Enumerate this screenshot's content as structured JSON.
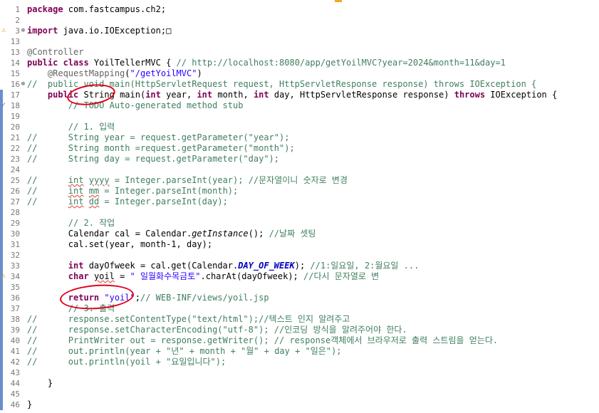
{
  "editor": {
    "lines": [
      {
        "n": "1",
        "html": "<span class='kw'>package</span> com.fastcampus.ch2;"
      },
      {
        "n": "2",
        "html": ""
      },
      {
        "n": "3",
        "html": "<span class='kw'>import</span> java.io.IOException;□"
      },
      {
        "n": "13",
        "html": ""
      },
      {
        "n": "13",
        "html": "<span class='ann'>@Controller</span>"
      },
      {
        "n": "14",
        "html": "<span class='kw'>public class</span> YoilTellerMVC { <span class='cm'>// http://localhost:8080/app/getYoilMVC?year=2024&month=11&day=1</span>"
      },
      {
        "n": "15",
        "html": "    <span class='ann'>@RequestMapping</span>(<span class='str'>\"/getYoilMVC\"</span>)"
      },
      {
        "n": "16",
        "html": "<span class='cm'>//  public void main(HttpServletRequest request, HttpServletResponse response) throws IOException {</span>"
      },
      {
        "n": "17",
        "html": "    <span class='kw'>public</span> String main(<span class='kw'>int</span> year, <span class='kw'>int</span> month, <span class='kw'>int</span> day, HttpServletResponse response) <span class='kw'>throws</span> IOException {"
      },
      {
        "n": "18",
        "html": "        <span class='cm'>// TODO Auto-generated method stub</span>"
      },
      {
        "n": "19",
        "html": ""
      },
      {
        "n": "20",
        "html": "        <span class='cm'>// 1. 입력</span>"
      },
      {
        "n": "21",
        "html": "<span class='cm'>//      String year = request.getParameter(\"year\");</span>"
      },
      {
        "n": "22",
        "html": "<span class='cm'>//      String month =request.getParameter(\"month\");</span>"
      },
      {
        "n": "23",
        "html": "<span class='cm'>//      String day = request.getParameter(\"day\");</span>"
      },
      {
        "n": "24",
        "html": ""
      },
      {
        "n": "25",
        "html": "<span class='cm'>//      <span class='sq'>int</span> <span class='sq'>yyyy</span> = Integer.parseInt(year); //문자열이니 숫자로 변경</span>"
      },
      {
        "n": "26",
        "html": "<span class='cm'>//      <span class='sq'>int</span> <span class='sq'>mm</span> = Integer.parseInt(month);</span>"
      },
      {
        "n": "27",
        "html": "<span class='cm'>//      <span class='sq'>int</span> <span class='sq'>dd</span> = Integer.parseInt(day);</span>"
      },
      {
        "n": "28",
        "html": ""
      },
      {
        "n": "29",
        "html": "        <span class='cm'>// 2. 작업</span>"
      },
      {
        "n": "30",
        "html": "        Calendar cal = Calendar.<span class='st'>getInstance</span>(); <span class='cm'>//날짜 셋팅</span>"
      },
      {
        "n": "31",
        "html": "        cal.set(year, month-1, day);"
      },
      {
        "n": "32",
        "html": ""
      },
      {
        "n": "33",
        "html": "        <span class='kw'>int</span> dayOfweek = cal.get(Calendar.<span class='fld'>DAY_OF_WEEK</span>); <span class='cm'>//1:일요일, 2:월요일 ...</span>"
      },
      {
        "n": "34",
        "html": "        <span class='kw'>char</span> <span class='sq'>yoil</span> = <span class='str'>\" 일월화수목금토\"</span>.charAt(dayOfweek); <span class='cm'>//다시 문자열로 변</span>"
      },
      {
        "n": "35",
        "html": ""
      },
      {
        "n": "36",
        "html": "        <span class='kw'>return</span> <span class='str'>\"yoil\"</span>;<span class='cm'>// WEB-INF/views/yoil.jsp</span>"
      },
      {
        "n": "37",
        "html": "        <span class='cm'>// 3. 출력</span>"
      },
      {
        "n": "38",
        "html": "<span class='cm'>//      response.setContentType(\"text/html\");//텍스트 인지 알려주고</span>"
      },
      {
        "n": "39",
        "html": "<span class='cm'>//      response.setCharacterEncoding(\"utf-8\"); //인코딩 방식을 알려주어야 한다.</span>"
      },
      {
        "n": "40",
        "html": "<span class='cm'>//      PrintWriter out = response.getWriter(); // response객체에서 브라우저로 출력 스트림을 얻는다.</span>"
      },
      {
        "n": "41",
        "html": "<span class='cm'>//      out.println(year + \"년\" + month + \"월\" + day + \"일은\");</span>"
      },
      {
        "n": "42",
        "html": "<span class='cm'>//      out.println(yoil + \"요일입니다\");</span>"
      },
      {
        "n": "43",
        "html": ""
      },
      {
        "n": "44",
        "html": "    }"
      },
      {
        "n": "45",
        "html": ""
      },
      {
        "n": "46",
        "html": "}"
      }
    ]
  },
  "markers": {
    "warning_lines": [
      "3",
      "34"
    ],
    "task_line": "18",
    "fold_lines": [
      "3",
      "16"
    ]
  },
  "colors": {
    "keyword": "#7f0055",
    "string": "#2a00ff",
    "comment": "#3f7f5f",
    "annotation": "#646464",
    "circle": "#e0001a"
  }
}
